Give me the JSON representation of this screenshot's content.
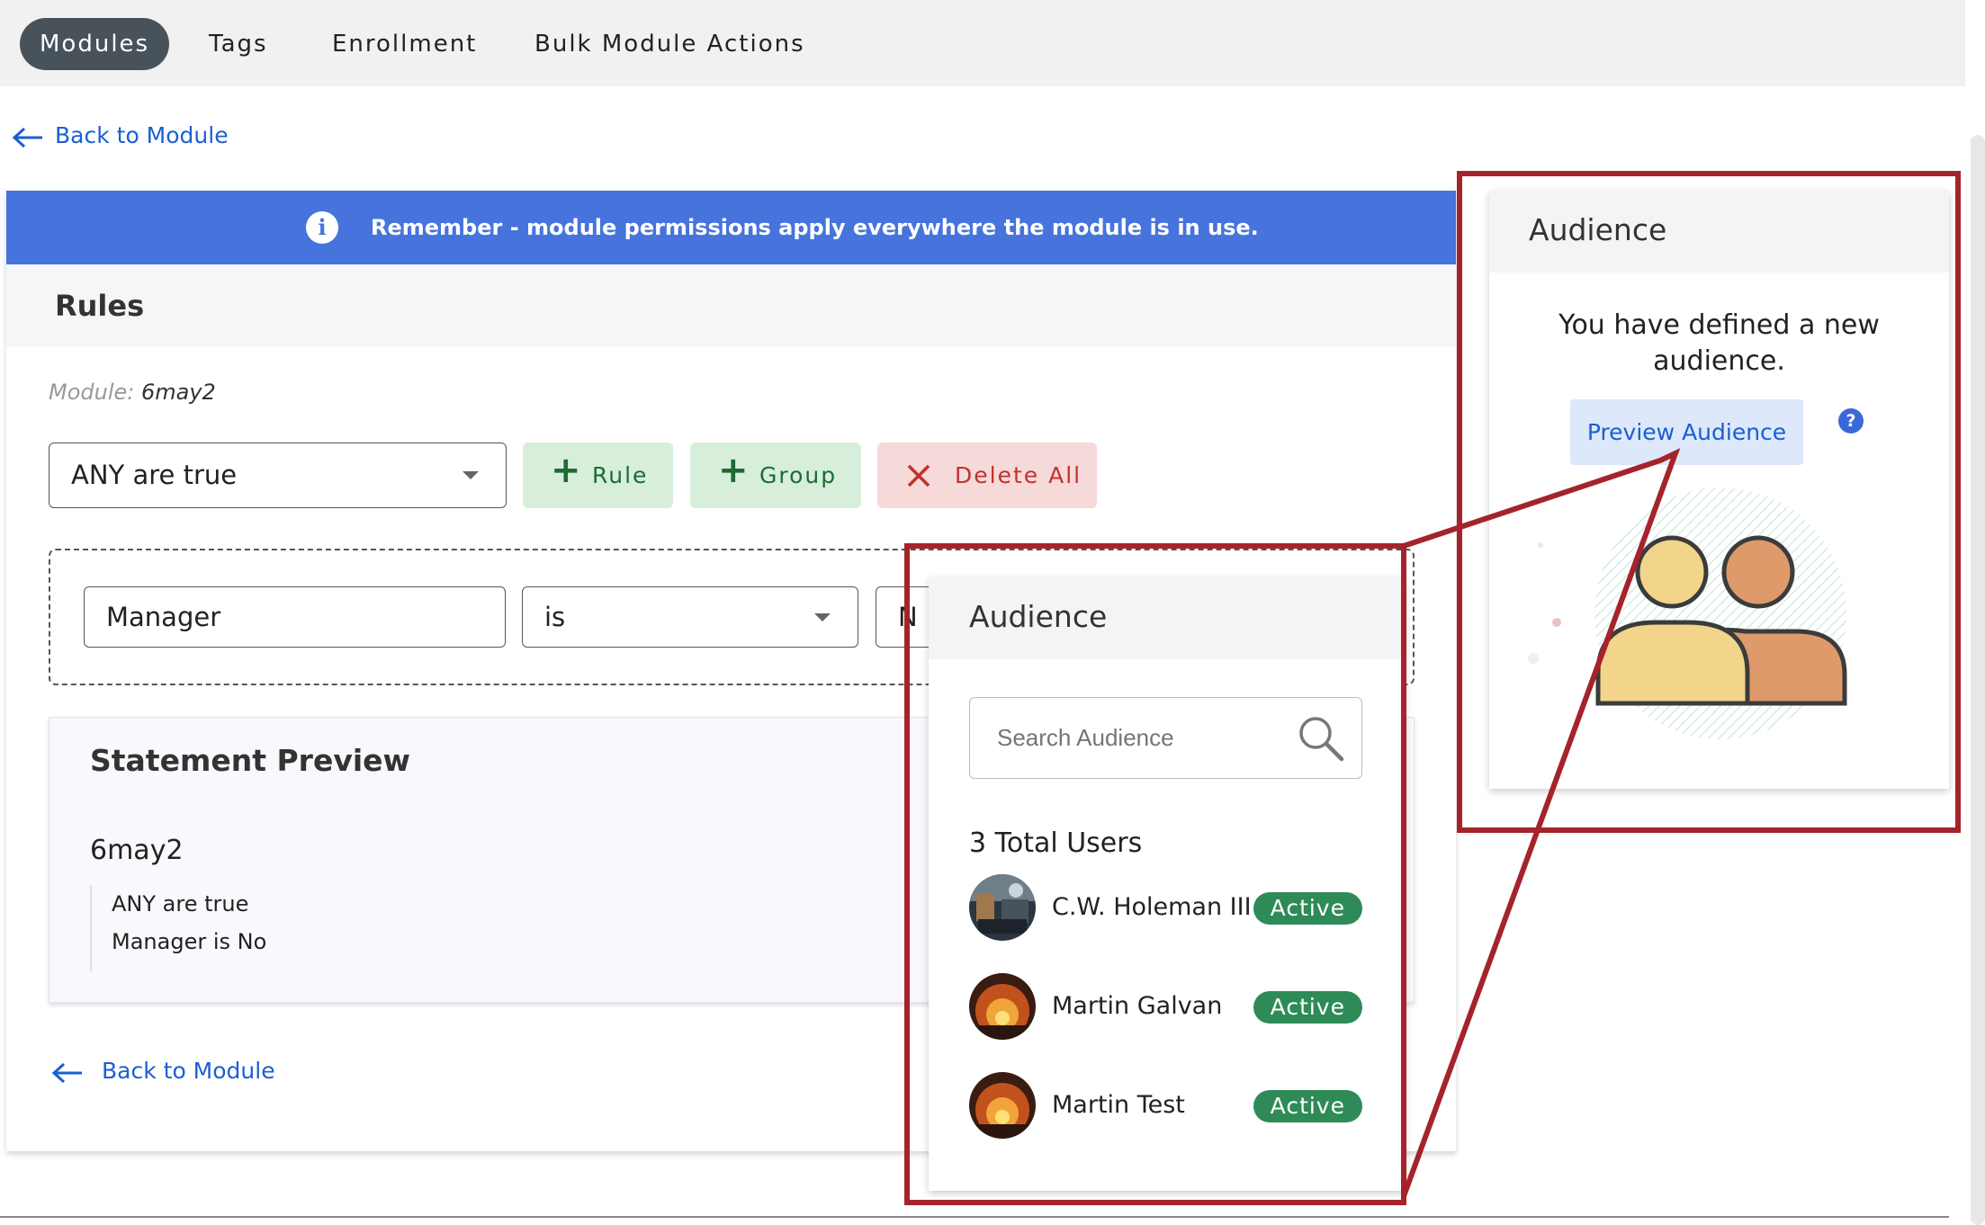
{
  "nav": {
    "modules": "Modules",
    "tags": "Tags",
    "enrollment": "Enrollment",
    "bulk": "Bulk Module Actions"
  },
  "back_link": "Back to Module",
  "banner": {
    "icon": "info-icon",
    "text": "Remember - module permissions apply everywhere the module is in use."
  },
  "rules": {
    "title": "Rules",
    "module_label": "Module:",
    "module_name": "6may2",
    "condition_select": "ANY are true",
    "add_rule": "Rule",
    "add_group": "Group",
    "delete_all": "Delete All",
    "rule_field": "Manager",
    "rule_operator": "is",
    "rule_value": "N"
  },
  "statement_preview": {
    "title": "Statement Preview",
    "module": "6may2",
    "lines": [
      "ANY are true",
      "Manager is No"
    ]
  },
  "audience_list": {
    "title": "Audience",
    "search_placeholder": "Search Audience",
    "total": "3 Total Users",
    "users": [
      {
        "name": "C.W. Holeman III",
        "status": "Active"
      },
      {
        "name": "Martin Galvan",
        "status": "Active"
      },
      {
        "name": "Martin Test",
        "status": "Active"
      }
    ]
  },
  "audience_panel": {
    "title": "Audience",
    "message": "You have defined a new audience.",
    "preview_button": "Preview Audience",
    "help": "?"
  },
  "colors": {
    "banner": "#4674dc",
    "link": "#1a5fd3",
    "active_badge": "#2e8b57",
    "annotation": "#a5232b"
  }
}
